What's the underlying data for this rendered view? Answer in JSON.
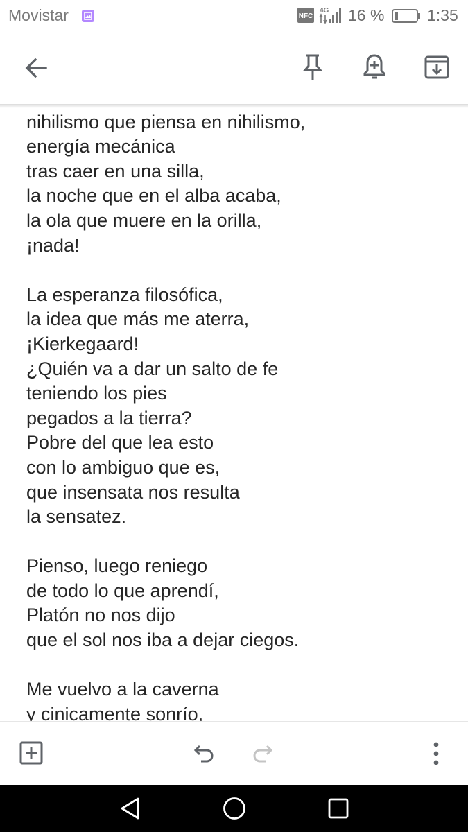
{
  "status_bar": {
    "carrier": "Movistar",
    "network": "4G",
    "battery_percent": "16 %",
    "time": "1:35",
    "icons": [
      "gallery-icon",
      "nfc-icon",
      "signal-icon",
      "battery-icon"
    ]
  },
  "toolbar": {
    "icons": [
      "back-arrow-icon",
      "pin-icon",
      "add-reminder-icon",
      "archive-icon"
    ]
  },
  "note": {
    "lines": [
      "nihilismo que piensa en nihilismo,",
      "energía mecánica",
      "tras caer en una silla,",
      "la noche que en el alba acaba,",
      "la ola que muere en la orilla,",
      "¡nada!",
      "",
      "La esperanza filosófica,",
      "la idea que más me aterra,",
      "¡Kierkegaard!",
      "¿Quién va a dar un salto de fe",
      "teniendo los pies",
      "pegados a la tierra?",
      "Pobre del que lea esto",
      "con lo ambiguo que es,",
      "que insensata nos resulta",
      "la sensatez.",
      "",
      "Pienso, luego reniego",
      "de todo lo que aprendí,",
      "Platón no nos dijo",
      "que el sol nos iba a dejar ciegos.",
      "",
      "Me vuelvo a la caverna",
      "y cinicamente sonrío,"
    ]
  },
  "bottom_toolbar": {
    "icons": [
      "add-box-icon",
      "undo-icon",
      "redo-icon",
      "more-vert-icon"
    ],
    "redo_enabled": false
  },
  "nav_bar": {
    "icons": [
      "nav-back-icon",
      "nav-home-icon",
      "nav-recent-icon"
    ]
  },
  "colors": {
    "text": "#262626",
    "icon": "#5f6368",
    "icon_disabled": "#c4c4c4",
    "gallery_badge": "#b388ff",
    "nav_bar": "#000000"
  }
}
